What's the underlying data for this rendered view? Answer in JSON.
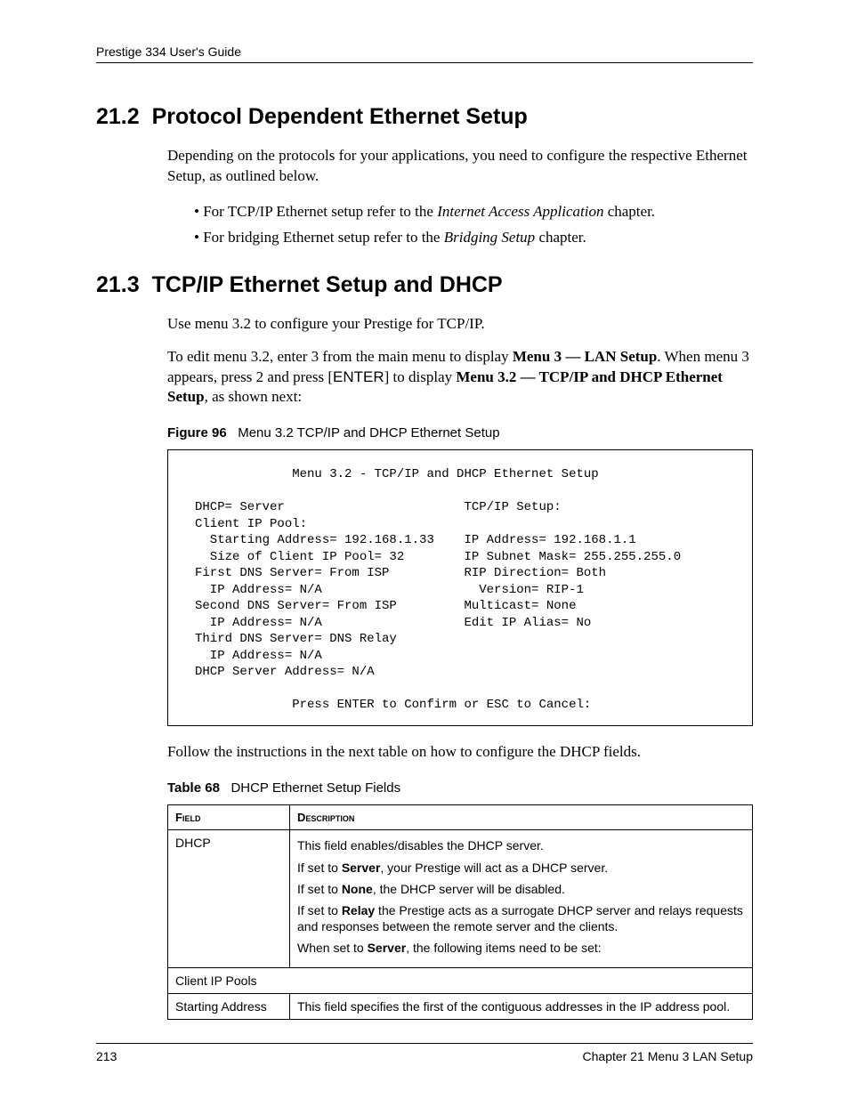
{
  "header": {
    "running_title": "Prestige 334 User's Guide"
  },
  "sections": {
    "s1": {
      "number": "21.2",
      "title": "Protocol Dependent Ethernet Setup",
      "intro": "Depending on the protocols for your applications, you need to configure the respective Ethernet Setup, as outlined below.",
      "bullet1_pre": "For TCP/IP Ethernet setup refer to the ",
      "bullet1_em": "Internet Access Application",
      "bullet1_post": " chapter.",
      "bullet2_pre": "For bridging Ethernet setup refer to the ",
      "bullet2_em": "Bridging Setup",
      "bullet2_post": " chapter."
    },
    "s2": {
      "number": "21.3",
      "title": "TCP/IP Ethernet Setup and DHCP",
      "p1": "Use menu 3.2 to configure your Prestige for TCP/IP.",
      "p2_pre": "To edit menu 3.2, enter 3 from the main menu to display ",
      "p2_b1": "Menu 3 — LAN Setup",
      "p2_mid1": ". When menu 3 appears, press 2 and press [",
      "p2_key": "ENTER",
      "p2_mid2": "] to display ",
      "p2_b2": "Menu 3.2 — TCP/IP and DHCP Ethernet Setup",
      "p2_post": ", as shown next:",
      "fig_label": "Figure 96",
      "fig_caption": "Menu 3.2 TCP/IP and DHCP Ethernet Setup",
      "after_fig": "Follow the instructions in the next table on how to configure the DHCP fields.",
      "tab_label": "Table 68",
      "tab_caption": "DHCP Ethernet Setup Fields"
    }
  },
  "figure_text": "             Menu 3.2 - TCP/IP and DHCP Ethernet Setup\n\nDHCP= Server                        TCP/IP Setup:\nClient IP Pool:\n  Starting Address= 192.168.1.33    IP Address= 192.168.1.1\n  Size of Client IP Pool= 32        IP Subnet Mask= 255.255.255.0\nFirst DNS Server= From ISP          RIP Direction= Both\n  IP Address= N/A                     Version= RIP-1\nSecond DNS Server= From ISP         Multicast= None\n  IP Address= N/A                   Edit IP Alias= No\nThird DNS Server= DNS Relay\n  IP Address= N/A\nDHCP Server Address= N/A\n\n             Press ENTER to Confirm or ESC to Cancel:",
  "table": {
    "headers": {
      "field": "Field",
      "desc": "Description"
    },
    "rows": {
      "dhcp": {
        "field": "DHCP",
        "d1": "This field enables/disables the DHCP server.",
        "d2a": "If set to ",
        "d2b": "Server",
        "d2c": ", your Prestige will act as a DHCP server.",
        "d3a": "If set to ",
        "d3b": "None",
        "d3c": ", the DHCP server will be disabled.",
        "d4a": "If set to ",
        "d4b": "Relay",
        "d4c": " the Prestige acts as a surrogate DHCP server and relays requests and responses between the remote server and the clients.",
        "d5a": "When set to ",
        "d5b": "Server",
        "d5c": ", the following items need to be set:"
      },
      "pools": {
        "field": "Client IP Pools"
      },
      "start": {
        "field": "Starting Address",
        "desc": "This field specifies the first of the contiguous addresses in the IP address pool."
      }
    }
  },
  "footer": {
    "page": "213",
    "chapter": "Chapter 21 Menu 3 LAN Setup"
  }
}
